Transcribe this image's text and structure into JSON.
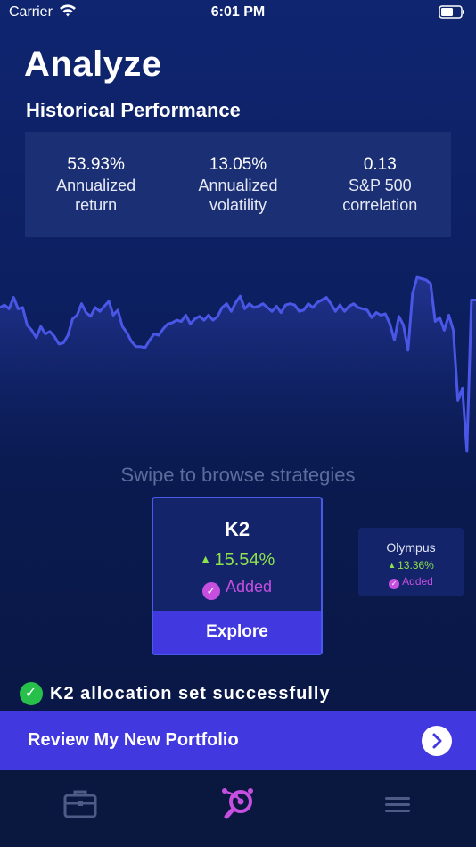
{
  "status_bar": {
    "carrier": "Carrier",
    "time": "6:01 PM"
  },
  "page": {
    "title": "Analyze"
  },
  "historical": {
    "title": "Historical Performance",
    "stats": [
      {
        "value": "53.93%",
        "label_line1": "Annualized",
        "label_line2": "return"
      },
      {
        "value": "13.05%",
        "label_line1": "Annualized",
        "label_line2": "volatility"
      },
      {
        "value": "0.13",
        "label_line1": "S&P 500",
        "label_line2": "correlation"
      }
    ]
  },
  "chart_data": {
    "type": "area",
    "x": [
      0,
      1,
      2,
      3,
      4,
      5,
      6,
      7,
      8,
      9,
      10,
      11,
      12,
      13,
      14,
      15,
      16,
      17,
      18,
      19,
      20,
      21,
      22,
      23,
      24,
      25,
      26,
      27,
      28,
      29,
      30,
      31,
      32,
      33,
      34,
      35,
      36,
      37,
      38,
      39,
      40,
      41,
      42,
      43,
      44,
      45,
      46,
      47,
      48,
      49,
      50,
      51,
      52,
      53,
      54,
      55,
      56,
      57,
      58,
      59,
      60,
      61,
      62,
      63,
      64,
      65,
      66,
      67,
      68,
      69,
      70,
      71,
      72,
      73,
      74,
      75,
      76,
      77,
      78,
      79,
      80,
      81,
      82,
      83,
      84,
      85,
      86,
      87,
      88,
      89,
      90,
      91,
      92,
      93,
      94,
      95,
      96,
      97,
      98,
      99,
      100,
      101,
      102,
      103,
      104,
      105
    ],
    "values": [
      44,
      46,
      43,
      52,
      43,
      44,
      30,
      26,
      20,
      29,
      23,
      25,
      21,
      15,
      16,
      22,
      35,
      38,
      47,
      40,
      37,
      44,
      41,
      45,
      49,
      38,
      42,
      29,
      24,
      17,
      13,
      13,
      12,
      18,
      23,
      22,
      27,
      31,
      32,
      34,
      33,
      38,
      31,
      35,
      37,
      34,
      38,
      34,
      37,
      44,
      47,
      41,
      48,
      53,
      43,
      47,
      44,
      45,
      47,
      44,
      41,
      45,
      40,
      46,
      47,
      46,
      41,
      42,
      47,
      44,
      48,
      50,
      52,
      47,
      41,
      46,
      41,
      45,
      47,
      44,
      43,
      42,
      36,
      40,
      38,
      39,
      31,
      18,
      37,
      30,
      10,
      55,
      68,
      67,
      66,
      63,
      33,
      36,
      26,
      38,
      26,
      -30,
      -20,
      -70,
      50,
      50
    ],
    "ylim": [
      -80,
      90
    ],
    "grid": false
  },
  "carousel": {
    "hint": "Swipe to browse strategies",
    "main": {
      "name": "K2",
      "change": "15.54%",
      "status": "Added",
      "explore_label": "Explore"
    },
    "side": {
      "name": "Olympus",
      "change": "13.36%",
      "status": "Added"
    }
  },
  "success_message": "K2 allocation set successfully",
  "review": {
    "label": "Review My New Portfolio"
  },
  "tabs": [
    "briefcase-icon",
    "analyze-icon",
    "menu-icon"
  ],
  "colors": {
    "accent": "#4238e0",
    "positive": "#8ee34c",
    "added": "#c64fe0",
    "success": "#27c04a",
    "line": "#4a57e6"
  }
}
